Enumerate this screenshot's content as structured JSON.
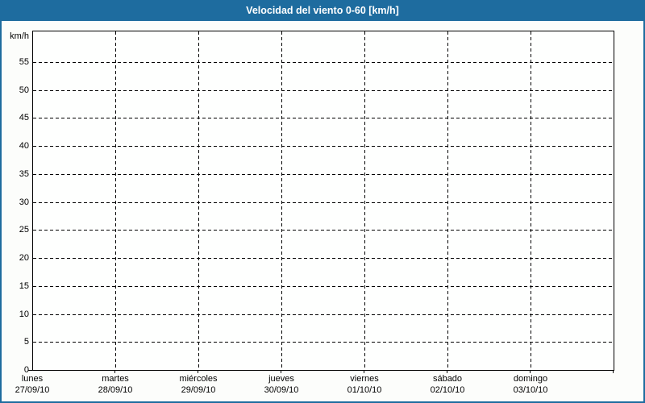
{
  "header": {
    "title": "Velocidad del viento 0-60 [km/h]"
  },
  "colors": {
    "header_bg": "#1e6c9f",
    "header_text": "#ffffff",
    "window_border": "#1e6c9f",
    "plot_border": "#000000",
    "grid": "#000000",
    "background": "#fcfdfb"
  },
  "chart_data": {
    "type": "line",
    "title": "Velocidad del viento 0-60 [km/h]",
    "ylabel": "km/h",
    "xlabel": "",
    "ylim": [
      0,
      60
    ],
    "y_ticks": [
      0,
      5,
      10,
      15,
      20,
      25,
      30,
      35,
      40,
      45,
      50,
      55
    ],
    "x_categories": [
      {
        "day": "lunes",
        "date": "27/09/10"
      },
      {
        "day": "martes",
        "date": "28/09/10"
      },
      {
        "day": "miércoles",
        "date": "29/09/10"
      },
      {
        "day": "jueves",
        "date": "30/09/10"
      },
      {
        "day": "viernes",
        "date": "01/10/10"
      },
      {
        "day": "sábado",
        "date": "02/10/10"
      },
      {
        "day": "domingo",
        "date": "03/10/10"
      }
    ],
    "series": [],
    "grid": {
      "style": "dashed",
      "horizontal": true,
      "vertical": true
    },
    "legend": "none"
  }
}
